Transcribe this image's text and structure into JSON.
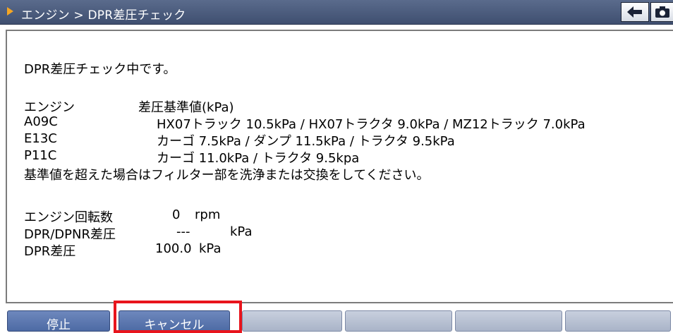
{
  "titlebar": {
    "breadcrumb": "エンジン > DPR差圧チェック",
    "back_icon": "left-arrow-icon",
    "home_icon": "camera-icon"
  },
  "content": {
    "status_message": "DPR差圧チェック中です。",
    "header_engine": "エンジン",
    "header_standard": "差圧基準値(kPa)",
    "engines": [
      {
        "model": "A09C",
        "values": "HX07トラック 10.5kPa  /  HX07トラクタ 9.0kPa  /  MZ12トラック 7.0kPa"
      },
      {
        "model": "E13C",
        "values": "カーゴ 7.5kPa  /  ダンプ 11.5kPa  /  トラクタ 9.5kPa"
      },
      {
        "model": "P11C",
        "values": "カーゴ 11.0kPa  /  トラクタ   9.5kpa"
      }
    ],
    "instruction": "基準値を超えた場合はフィルター部を洗浄または交換をしてください。",
    "readings": [
      {
        "label": "エンジン回転数",
        "value": "0",
        "unit": "rpm"
      },
      {
        "label": "DPR/DPNR差圧",
        "value": "---",
        "unit": "kPa"
      },
      {
        "label": "DPR差圧",
        "value": "100.0",
        "unit": "kPa"
      }
    ]
  },
  "buttons": {
    "stop": "停止",
    "cancel": "キャンセル",
    "f3": "",
    "f4": "",
    "f5": "",
    "f6": "",
    "f7": ""
  },
  "colors": {
    "titlebar": "#4a5a7c",
    "active_button": "#5a75ad",
    "inactive_button": "#b8c1d3",
    "highlight": "#e8141c"
  }
}
